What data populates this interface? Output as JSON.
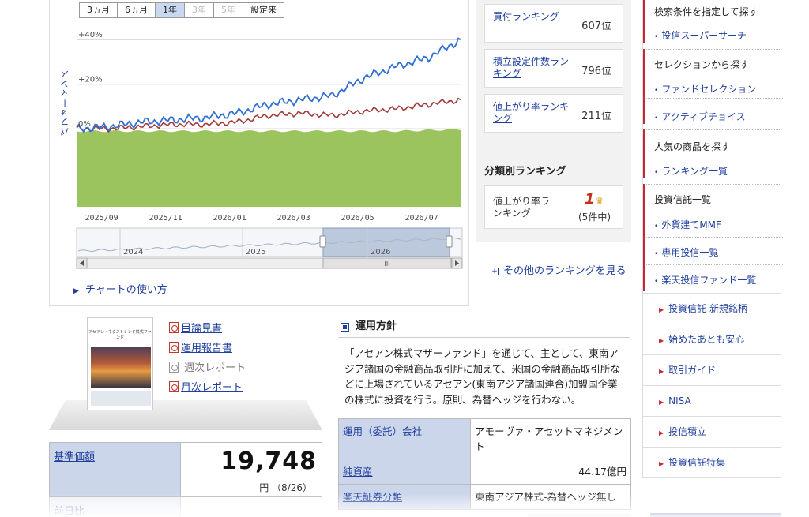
{
  "chart": {
    "periods": [
      {
        "label": "3ヵ月",
        "state": "normal"
      },
      {
        "label": "6ヵ月",
        "state": "normal"
      },
      {
        "label": "1年",
        "state": "active"
      },
      {
        "label": "3年",
        "state": "disabled"
      },
      {
        "label": "5年",
        "state": "disabled"
      },
      {
        "label": "設定来",
        "state": "normal"
      }
    ],
    "ylabel": "パフォーマンス",
    "y_ticks": [
      "+40%",
      "+20%",
      "0%"
    ],
    "x_ticks": [
      "2025/09",
      "2025/11",
      "2026/01",
      "2026/03",
      "2026/05",
      "2026/07"
    ],
    "nav_years": [
      "2024",
      "2025",
      "2026"
    ],
    "scroll_grip": "III",
    "help_link": "チャートの使い方",
    "colors": {
      "blue": "#2f6fd6",
      "red": "#a23a3a",
      "green": "#9cc45e",
      "nav": "#aab9d2"
    }
  },
  "chart_data": {
    "type": "line",
    "xlabel": "",
    "ylabel": "パフォーマンス",
    "x": [
      "2025/08",
      "2025/09",
      "2025/10",
      "2025/11",
      "2025/12",
      "2026/01",
      "2026/02",
      "2026/03",
      "2026/04",
      "2026/05",
      "2026/06",
      "2026/07",
      "2026/08"
    ],
    "series": [
      {
        "values": [
          0,
          1,
          3,
          4,
          5,
          7,
          11,
          13,
          15,
          23,
          28,
          32,
          40
        ]
      },
      {
        "values": [
          0,
          0,
          1,
          2,
          2,
          3,
          6,
          7,
          6,
          8,
          9,
          11,
          13
        ]
      }
    ],
    "ylim": [
      -35,
      50
    ],
    "y_ticks_values": [
      0,
      20,
      40
    ],
    "grid": true
  },
  "ranking": {
    "items": [
      {
        "label": "買付ランキング",
        "value": "607位"
      },
      {
        "label": "積立設定件数ランキング",
        "value": "796位"
      },
      {
        "label": "値上がり率ランキング",
        "value": "211位"
      }
    ],
    "category_title": "分類別ランキング",
    "category": {
      "label": "値上がり率ランキング",
      "rank": "1",
      "sub": "(5件中)"
    },
    "more_link": "その他のランキングを見る"
  },
  "sidebar": {
    "sections": [
      {
        "head": "検索条件を指定して探す",
        "items": [
          "投信スーパーサーチ"
        ]
      },
      {
        "head": "セレクションから探す",
        "items": [
          "ファンドセレクション",
          "アクティブチョイス"
        ]
      },
      {
        "head": "人気の商品を探す",
        "items": [
          "ランキング一覧"
        ]
      },
      {
        "head": "投資信託一覧",
        "items": [
          "外貨建てMMF",
          "専用投信一覧",
          "楽天投信ファンド一覧"
        ]
      }
    ],
    "links": [
      "投資信託 新規銘柄",
      "始めたあとも安心",
      "取引ガイド",
      "NISA",
      "投信積立",
      "投資信託特集"
    ]
  },
  "documents": {
    "thumb_title": "アセアン・ネクストレンド株式ファンド",
    "items": [
      {
        "label": "目論見書",
        "enabled": true
      },
      {
        "label": "運用報告書",
        "enabled": true
      },
      {
        "label": "週次レポート",
        "enabled": false
      },
      {
        "label": "月次レポート",
        "enabled": true
      }
    ]
  },
  "price": {
    "label": "基準価額",
    "value": "19,748",
    "unit": "円 （8/26）",
    "prev_label": "前日比"
  },
  "policy": {
    "title": "運用方針",
    "text": "「アセアン株式マザーファンド」を通じて、主として、東南アジア諸国の金融商品取引所に加えて、米国の金融商品取引所などに上場されているアセアン(東南アジア諸国連合)加盟国企業の株式に投資を行う。原則、為替ヘッジを行わない。",
    "rows": [
      {
        "key": "運用（委託）会社",
        "value": "アモーヴァ・アセットマネジメント"
      },
      {
        "key": "純資産",
        "value": "44.17億円"
      },
      {
        "key": "楽天証券分類",
        "value": "東南アジア株式-為替ヘッジ無し"
      }
    ]
  }
}
